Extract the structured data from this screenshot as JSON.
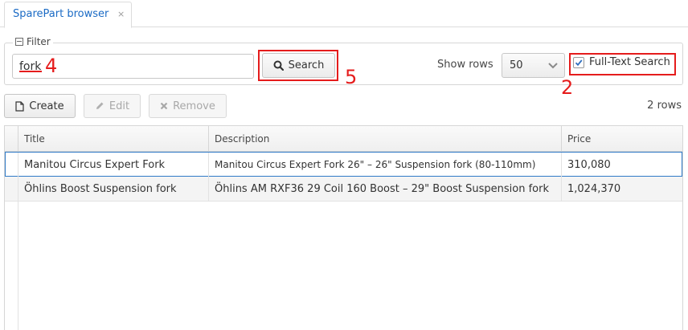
{
  "tab": {
    "title": "SparePart browser",
    "close": "×"
  },
  "filter": {
    "legend": "Filter",
    "search_value": "fork",
    "search_button": "Search",
    "show_rows_label": "Show rows",
    "rows_value": "50",
    "full_text_label": "Full-Text Search",
    "full_text_checked": true
  },
  "toolbar": {
    "create": "Create",
    "edit": "Edit",
    "remove": "Remove",
    "row_count": "2 rows"
  },
  "table": {
    "columns": [
      "Title",
      "Description",
      "Price"
    ],
    "rows": [
      {
        "title": "Manitou Circus Expert Fork",
        "description": "Manitou Circus Expert Fork 26\" – 26\" Suspension fork (80-110mm)",
        "price": "310,080"
      },
      {
        "title": "Öhlins Boost Suspension fork",
        "description": "Öhlins AM RXF36 29 Coil 160 Boost – 29\" Boost Suspension fork",
        "price": "1,024,370"
      }
    ]
  },
  "annotations": {
    "a4": "4",
    "a5": "5",
    "a2": "2"
  },
  "colors": {
    "accent": "#1b6bc5",
    "annotation": "#e51c1c",
    "selection": "#2f7ac7"
  }
}
